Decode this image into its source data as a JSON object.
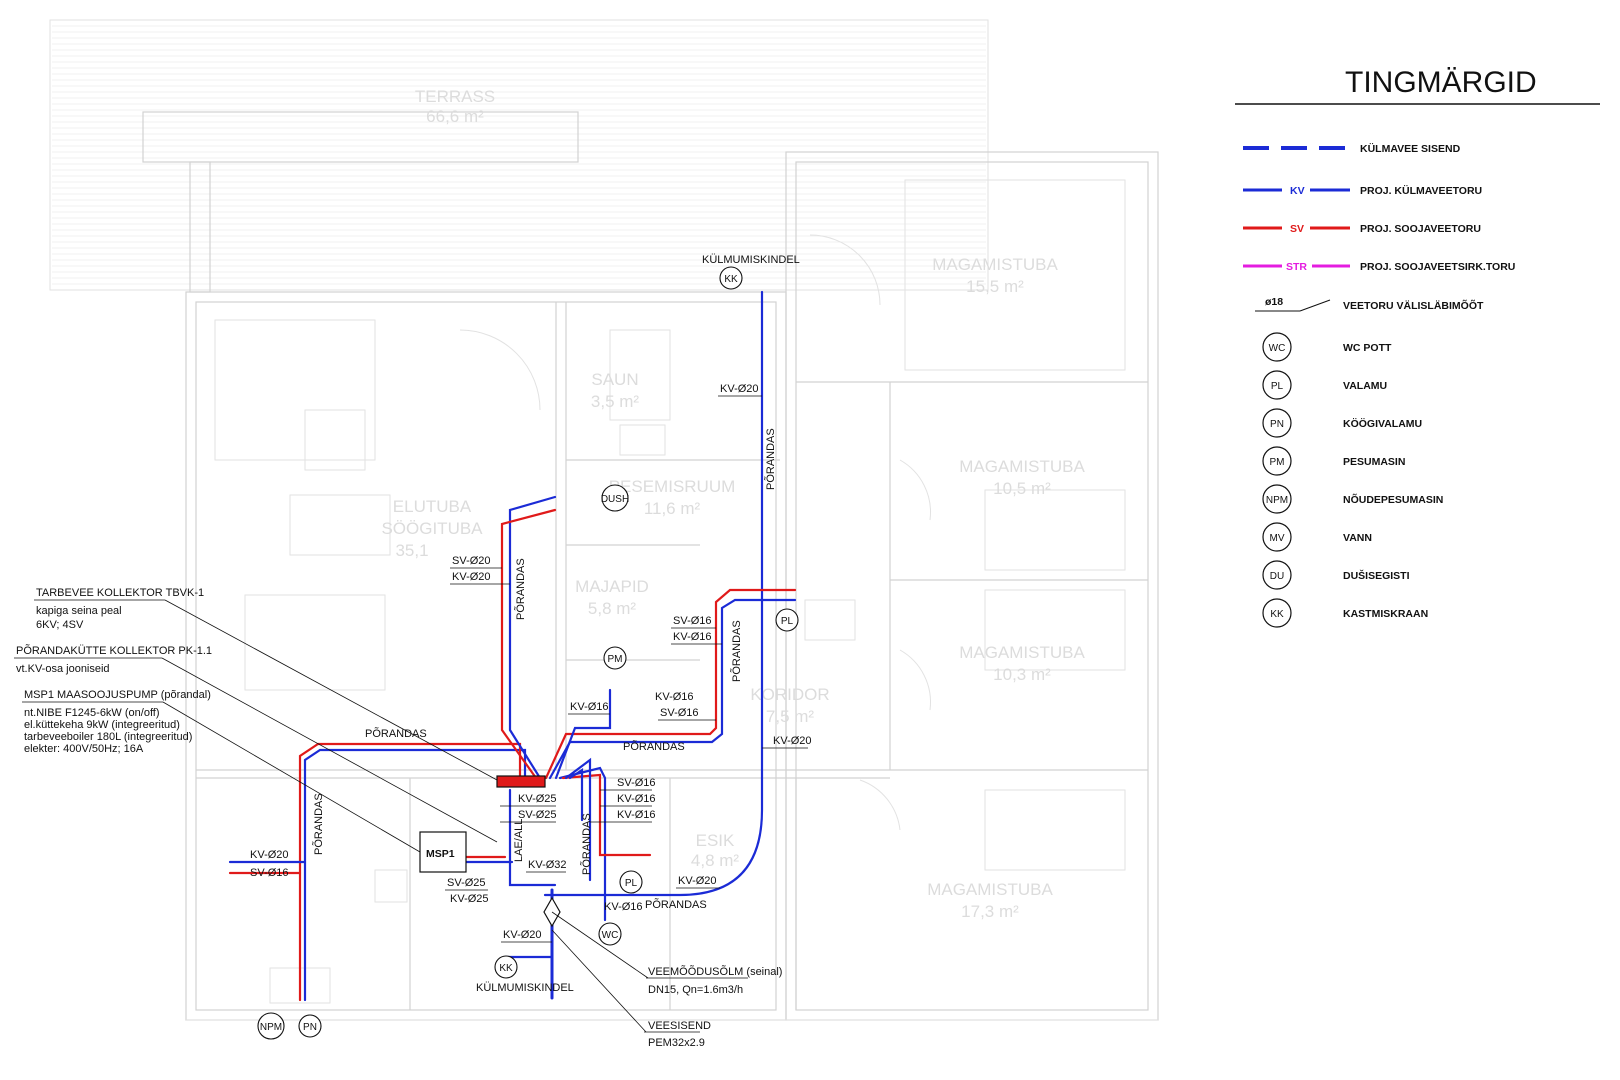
{
  "colors": {
    "kv": "#1b2bd6",
    "sv": "#e01a1a",
    "str": "#e41ce0",
    "ink": "#111111",
    "faint": "#d6d6d6"
  },
  "legend": {
    "title": "TINGMÄRGID",
    "items": [
      {
        "label": "KÜLMAVEE SISEND"
      },
      {
        "tag": "KV",
        "label": "PROJ. KÜLMAVEETORU"
      },
      {
        "tag": "SV",
        "label": "PROJ. SOOJAVEETORU"
      },
      {
        "tag": "STR",
        "label": "PROJ. SOOJAVEETSIRK.TORU"
      },
      {
        "tag": "ø18",
        "label": "VEETORU VÄLISLÄBIMÕÕT"
      },
      {
        "tag": "WC",
        "label": "WC POTT"
      },
      {
        "tag": "PL",
        "label": "VALAMU"
      },
      {
        "tag": "PN",
        "label": "KÖÖGIVALAMU"
      },
      {
        "tag": "PM",
        "label": "PESUMASIN"
      },
      {
        "tag": "NPM",
        "label": "NÕUDEPESUMASIN"
      },
      {
        "tag": "MV",
        "label": "VANN"
      },
      {
        "tag": "DU",
        "label": "DUŠISEGISTI"
      },
      {
        "tag": "KK",
        "label": "KASTMISKRAAN"
      }
    ]
  },
  "rooms": [
    {
      "name": "TERRASS",
      "area": "66,6 m²"
    },
    {
      "name": "MAGAMISTUBA",
      "area": "15,5 m²"
    },
    {
      "name": "SAUN",
      "area": "3,5 m²"
    },
    {
      "name": "PESEMISRUUM",
      "area": "11,6 m²"
    },
    {
      "name": "ELUTUBA",
      "sub": "SÖÖGITUBA",
      "area": "35,1"
    },
    {
      "name": "MAJAPID",
      "area": "5,8 m²"
    },
    {
      "name": "MAGAMISTUBA",
      "area": "10,5 m²"
    },
    {
      "name": "MAGAMISTUBA",
      "area": "10,3 m²"
    },
    {
      "name": "KORIDOR",
      "area": "7,5 m²"
    },
    {
      "name": "ESIK",
      "area": "4,8 m²"
    },
    {
      "name": "MAGAMISTUBA",
      "area": "17,3 m²"
    }
  ],
  "fixtures": {
    "kk_top": "KK",
    "kk_bottom": "KK",
    "dush": "DUSH",
    "pm": "PM",
    "pl_right": "PL",
    "pl_mid": "PL",
    "wc": "WC",
    "npm": "NPM",
    "pn": "PN",
    "msp": "MSP1"
  },
  "labels": {
    "kylmumiskindel_top": "KÜLMUMISKINDEL",
    "kylmumiskindel_bottom": "KÜLMUMISKINDEL",
    "kv020_top": "KV-Ø20",
    "porandas_v_top": "PÕRANDAS",
    "sv020_a": "SV-Ø20",
    "kv020_a": "KV-Ø20",
    "porandas_v_a": "PÕRANDAS",
    "sv016_b": "SV-Ø16",
    "kv016_b": "KV-Ø16",
    "porandas_v_b": "PÕRANDAS",
    "kv016_c": "KV-Ø16",
    "kv016_d": "KV-Ø16",
    "sv016_d": "SV-Ø16",
    "porandas_h_d": "PÕRANDAS",
    "kv020_e": "KV-Ø20",
    "porandas_h_top": "PÕRANDAS",
    "kv025": "KV-Ø25",
    "sv025": "SV-Ø25",
    "lae_all": "LAE/ALL",
    "sv016_f": "SV-Ø16",
    "kv016_f1": "KV-Ø16",
    "kv016_f2": "KV-Ø16",
    "porandas_v_f": "PÕRANDAS",
    "kv032": "KV-Ø32",
    "sv025_g": "SV-Ø25",
    "kv025_g": "KV-Ø25",
    "kv020_h": "KV-Ø20",
    "porandas_h_h": "PÕRANDAS",
    "kv016_i": "KV-Ø16",
    "kv020_left": "KV-Ø20",
    "sv016_left": "SV-Ø16",
    "porandas_v_left": "PÕRANDAS",
    "kv020_meter": "KV-Ø20",
    "meter_title": "VEEMÕÕDUSÕLM (seinal)",
    "meter_spec": "DN15, Qn=1.6m3/h",
    "inlet_title": "VEESISEND",
    "inlet_spec": "PEM32x2.9"
  },
  "callouts": {
    "tbvk_title": "TARBEVEE KOLLEKTOR TBVK-1",
    "tbvk_line1": "kapiga seina peal",
    "tbvk_line2": "6KV; 4SV",
    "pk_title": "PÕRANDAKÜTTE KOLLEKTOR PK-1.1",
    "pk_line1": "vt.KV-osa jooniseid",
    "msp_title": "MSP1 MAASOOJUSPUMP (põrandal)",
    "msp_line1": "nt.NIBE F1245-6kW (on/off)",
    "msp_line2": "el.küttekeha 9kW (integreeritud)",
    "msp_line3": "tarbeveeboiler 180L (integreeritud)",
    "msp_line4": "elekter: 400V/50Hz; 16A"
  }
}
